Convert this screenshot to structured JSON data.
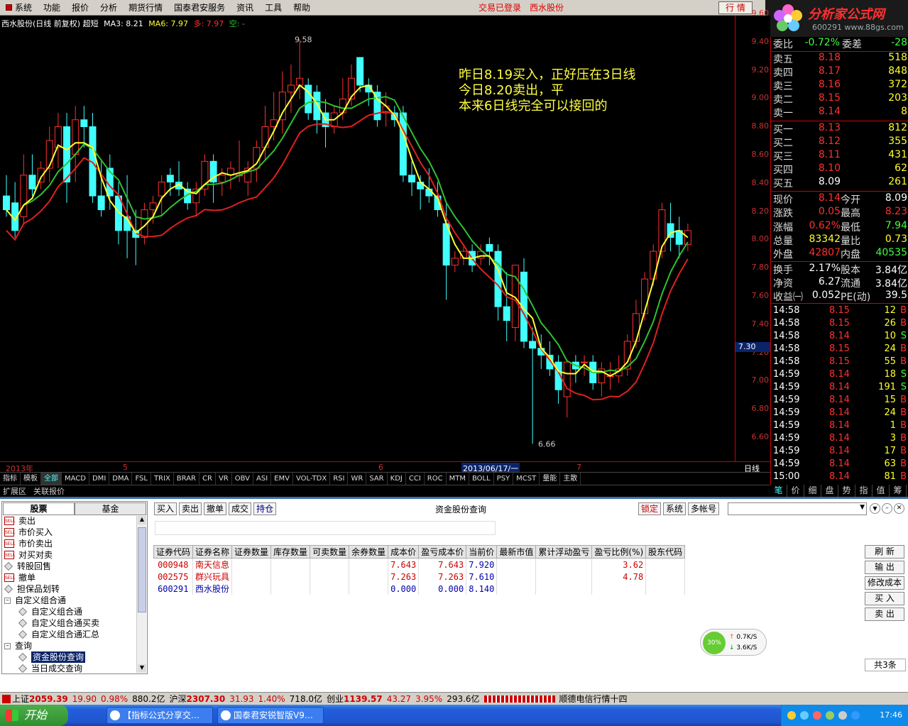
{
  "menu": {
    "items": [
      "系统",
      "功能",
      "报价",
      "分析",
      "期货行情",
      "国泰君安服务",
      "资讯",
      "工具",
      "帮助"
    ],
    "login_status": "交易已登录",
    "stock_name": "西水股份",
    "quote_button": "行 情",
    "logo_text": "分析家公式网",
    "logo_url": "www.88gs.com",
    "logo_code": "600291"
  },
  "chart": {
    "header": {
      "title": "西水股份(日线 前复权) 超短",
      "ma3": "MA3: 8.21",
      "ma6": "MA6: 7.97",
      "duo": "多: 7.97",
      "kong": "空: -"
    },
    "annotation": [
      "昨日8.19买入，正好压在3日线",
      "今日8.20卖出，平",
      "本来6日线完全可以接回的"
    ],
    "high_label": "9.58",
    "low_label": "6.66",
    "cursor_price": "7.30",
    "date_labels": [
      "2013年",
      "5",
      "6",
      "2013/06/17/一",
      "7"
    ],
    "period": "日线",
    "price_ticks": [
      "9.60",
      "9.40",
      "9.20",
      "9.00",
      "8.80",
      "8.60",
      "8.40",
      "8.20",
      "8.00",
      "7.80",
      "7.60",
      "7.40",
      "7.20",
      "7.00",
      "6.80",
      "6.60"
    ],
    "colors": {
      "up": "#ff3030",
      "down": "#40ffff",
      "ma3": "#ffff30",
      "ma6": "#30c030",
      "kong": "#e02020"
    }
  },
  "chart_data": {
    "type": "candlestick",
    "title": "西水股份(日线 前复权) 超短",
    "ylim": [
      6.6,
      9.66
    ],
    "candles": [
      [
        8.45,
        8.6,
        8.3,
        8.35
      ],
      [
        8.4,
        8.55,
        8.15,
        8.2
      ],
      [
        8.3,
        8.75,
        8.25,
        8.6
      ],
      [
        8.6,
        8.75,
        8.45,
        8.5
      ],
      [
        8.55,
        8.7,
        8.5,
        8.65
      ],
      [
        8.65,
        8.95,
        8.55,
        8.85
      ],
      [
        8.8,
        9.05,
        8.65,
        8.95
      ],
      [
        8.95,
        9.05,
        8.4,
        8.55
      ],
      [
        8.75,
        9.1,
        8.55,
        9.0
      ],
      [
        9.0,
        9.1,
        8.8,
        8.95
      ],
      [
        8.95,
        9.05,
        8.4,
        8.45
      ],
      [
        8.45,
        8.7,
        8.3,
        8.35
      ],
      [
        8.65,
        8.75,
        8.35,
        8.45
      ],
      [
        8.45,
        8.55,
        8.1,
        8.2
      ],
      [
        8.3,
        8.6,
        8.0,
        8.2
      ],
      [
        8.2,
        8.35,
        7.95,
        8.15
      ],
      [
        8.15,
        8.4,
        8.1,
        8.35
      ],
      [
        8.35,
        8.45,
        8.25,
        8.4
      ],
      [
        8.45,
        8.6,
        8.3,
        8.55
      ],
      [
        8.6,
        8.65,
        8.45,
        8.55
      ],
      [
        8.55,
        8.7,
        8.45,
        8.5
      ],
      [
        8.5,
        8.55,
        8.35,
        8.4
      ],
      [
        8.4,
        8.55,
        8.3,
        8.5
      ],
      [
        8.5,
        8.75,
        8.45,
        8.7
      ],
      [
        8.7,
        8.75,
        8.4,
        8.55
      ],
      [
        8.55,
        8.65,
        8.45,
        8.6
      ],
      [
        8.6,
        8.7,
        8.5,
        8.65
      ],
      [
        8.6,
        8.85,
        8.55,
        8.6
      ],
      [
        8.55,
        8.7,
        8.45,
        8.65
      ],
      [
        8.65,
        8.85,
        8.55,
        8.8
      ],
      [
        8.8,
        9.1,
        8.7,
        8.95
      ],
      [
        8.95,
        9.2,
        8.85,
        9.0
      ],
      [
        9.0,
        9.35,
        8.9,
        9.2
      ],
      [
        9.2,
        9.4,
        9.05,
        9.25
      ],
      [
        9.25,
        9.58,
        9.15,
        9.3
      ],
      [
        9.25,
        9.3,
        9.0,
        9.05
      ],
      [
        9.2,
        9.25,
        8.9,
        9.0
      ],
      [
        9.05,
        9.15,
        8.8,
        8.95
      ],
      [
        8.95,
        9.1,
        8.9,
        9.05
      ],
      [
        9.05,
        9.3,
        9.0,
        9.15
      ],
      [
        9.15,
        9.4,
        9.1,
        9.3
      ],
      [
        9.45,
        9.45,
        9.2,
        9.25
      ],
      [
        9.25,
        9.3,
        9.1,
        9.2
      ],
      [
        9.2,
        9.25,
        8.95,
        9.0
      ],
      [
        9.05,
        9.2,
        8.95,
        9.1
      ],
      [
        9.05,
        9.1,
        8.95,
        9.0
      ],
      [
        9.05,
        9.1,
        8.55,
        8.6
      ],
      [
        8.6,
        8.7,
        8.45,
        8.55
      ],
      [
        8.55,
        8.6,
        8.35,
        8.5
      ],
      [
        8.5,
        8.65,
        8.4,
        8.45
      ],
      [
        8.45,
        8.55,
        8.3,
        8.35
      ],
      [
        8.25,
        8.4,
        7.7,
        7.95
      ],
      [
        7.95,
        8.05,
        7.9,
        8.0
      ],
      [
        8.0,
        8.1,
        7.95,
        8.05
      ],
      [
        8.05,
        8.1,
        7.9,
        7.95
      ],
      [
        8.0,
        8.1,
        7.95,
        8.05
      ],
      [
        8.1,
        8.15,
        7.95,
        8.05
      ],
      [
        8.05,
        8.1,
        7.55,
        7.65
      ],
      [
        7.65,
        7.9,
        7.4,
        7.55
      ],
      [
        7.5,
        7.95,
        7.4,
        7.95
      ],
      [
        7.9,
        8.0,
        7.35,
        7.4
      ],
      [
        7.4,
        7.5,
        6.66,
        7.35
      ],
      [
        7.35,
        7.45,
        7.2,
        7.3
      ],
      [
        7.3,
        7.4,
        7.15,
        7.2
      ],
      [
        7.25,
        7.3,
        6.95,
        7.05
      ],
      [
        7.0,
        7.25,
        6.85,
        7.25
      ],
      [
        7.25,
        7.3,
        7.1,
        7.2
      ],
      [
        7.25,
        7.3,
        7.15,
        7.25
      ],
      [
        7.25,
        7.3,
        7.05,
        7.1
      ],
      [
        7.1,
        7.25,
        7.0,
        7.2
      ],
      [
        7.15,
        7.25,
        7.05,
        7.15
      ],
      [
        7.15,
        7.3,
        7.1,
        7.2
      ],
      [
        7.2,
        7.45,
        7.15,
        7.4
      ],
      [
        7.4,
        7.7,
        7.35,
        7.6
      ],
      [
        7.6,
        7.9,
        7.55,
        7.85
      ],
      [
        7.85,
        8.1,
        7.8,
        8.05
      ],
      [
        8.05,
        8.4,
        8.0,
        8.35
      ],
      [
        8.25,
        8.4,
        8.05,
        8.15
      ],
      [
        8.2,
        8.3,
        8.0,
        8.1
      ],
      [
        8.1,
        8.25,
        8.05,
        8.2
      ]
    ]
  },
  "indicator_tabs": [
    "指标",
    "模板",
    "全部",
    "MACD",
    "DMI",
    "DMA",
    "FSL",
    "TRIX",
    "BRAR",
    "CR",
    "VR",
    "OBV",
    "ASI",
    "EMV",
    "VOL-TDX",
    "RSI",
    "WR",
    "SAR",
    "KDJ",
    "CCI",
    "ROC",
    "MTM",
    "BOLL",
    "PSY",
    "MCST",
    "量能",
    "主散"
  ],
  "ext_tabs": [
    "扩展区",
    "关联报价"
  ],
  "quote": {
    "header": {
      "label1": "委比",
      "val1": "-0.72%",
      "label2": "委差",
      "val2": "-28"
    },
    "sell": [
      {
        "label": "卖五",
        "price": "8.18",
        "vol": "518"
      },
      {
        "label": "卖四",
        "price": "8.17",
        "vol": "848"
      },
      {
        "label": "卖三",
        "price": "8.16",
        "vol": "372"
      },
      {
        "label": "卖二",
        "price": "8.15",
        "vol": "203"
      },
      {
        "label": "卖一",
        "price": "8.14",
        "vol": "8"
      }
    ],
    "buy": [
      {
        "label": "买一",
        "price": "8.13",
        "vol": "812"
      },
      {
        "label": "买二",
        "price": "8.12",
        "vol": "355"
      },
      {
        "label": "买三",
        "price": "8.11",
        "vol": "431"
      },
      {
        "label": "买四",
        "price": "8.10",
        "vol": "62"
      },
      {
        "label": "买五",
        "price": "8.09",
        "vol": "261"
      }
    ],
    "stats": [
      {
        "l1": "现价",
        "v1": "8.14",
        "l2": "今开",
        "v2": "8.09"
      },
      {
        "l1": "涨跌",
        "v1": "0.05",
        "l2": "最高",
        "v2": "8.23"
      },
      {
        "l1": "涨幅",
        "v1": "0.62%",
        "l2": "最低",
        "v2": "7.94"
      },
      {
        "l1": "总量",
        "v1": "83342",
        "l2": "量比",
        "v2": "0.73"
      },
      {
        "l1": "外盘",
        "v1": "42807",
        "l2": "内盘",
        "v2": "40535"
      },
      {
        "l1": "换手",
        "v1": "2.17%",
        "l2": "股本",
        "v2": "3.84亿"
      },
      {
        "l1": "净资",
        "v1": "6.27",
        "l2": "流通",
        "v2": "3.84亿"
      },
      {
        "l1": "收益㈠",
        "v1": "0.052",
        "l2": "PE(动)",
        "v2": "39.5"
      }
    ],
    "ticks": [
      {
        "t": "14:58",
        "p": "8.15",
        "v": "12",
        "s": "B"
      },
      {
        "t": "14:58",
        "p": "8.15",
        "v": "26",
        "s": "B"
      },
      {
        "t": "14:58",
        "p": "8.14",
        "v": "10",
        "s": "S"
      },
      {
        "t": "14:58",
        "p": "8.15",
        "v": "24",
        "s": "B"
      },
      {
        "t": "14:58",
        "p": "8.15",
        "v": "55",
        "s": "B"
      },
      {
        "t": "14:59",
        "p": "8.14",
        "v": "18",
        "s": "S"
      },
      {
        "t": "14:59",
        "p": "8.14",
        "v": "191",
        "s": "S"
      },
      {
        "t": "14:59",
        "p": "8.14",
        "v": "15",
        "s": "B"
      },
      {
        "t": "14:59",
        "p": "8.14",
        "v": "24",
        "s": "B"
      },
      {
        "t": "14:59",
        "p": "8.14",
        "v": "1",
        "s": "B"
      },
      {
        "t": "14:59",
        "p": "8.14",
        "v": "3",
        "s": "B"
      },
      {
        "t": "14:59",
        "p": "8.14",
        "v": "17",
        "s": "B"
      },
      {
        "t": "14:59",
        "p": "8.14",
        "v": "63",
        "s": "B"
      },
      {
        "t": "15:00",
        "p": "8.14",
        "v": "81",
        "s": "B"
      }
    ],
    "tabs": [
      "笔",
      "价",
      "细",
      "盘",
      "势",
      "指",
      "值",
      "筹"
    ]
  },
  "trade": {
    "left_tabs": [
      "股票",
      "基金"
    ],
    "nav": [
      {
        "label": "卖出",
        "type": "sell"
      },
      {
        "label": "市价买入",
        "type": "sell"
      },
      {
        "label": "市价卖出",
        "type": "sell"
      },
      {
        "label": "对买对卖",
        "type": "sell"
      },
      {
        "label": "转股回售",
        "type": "dia"
      },
      {
        "label": "撤单",
        "type": "sell"
      },
      {
        "label": "担保品划转",
        "type": "dia"
      },
      {
        "label": "自定义组合通",
        "type": "box"
      },
      {
        "label": "自定义组合通",
        "type": "dia2"
      },
      {
        "label": "自定义组合通买卖",
        "type": "dia2"
      },
      {
        "label": "自定义组合通汇总",
        "type": "dia2"
      },
      {
        "label": "查询",
        "type": "box"
      },
      {
        "label": "资金股份查询",
        "type": "dia2",
        "sel": true
      },
      {
        "label": "当日成交查询",
        "type": "dia2"
      }
    ],
    "toolbar": [
      "买入",
      "卖出",
      "撤单",
      "成交",
      "持仓"
    ],
    "title": "资金股份查询",
    "right_buttons": [
      "锁定",
      "系统",
      "多帐号"
    ],
    "columns": [
      "证券代码",
      "证券名称",
      "证券数量",
      "库存数量",
      "可卖数量",
      "余券数量",
      "成本价",
      "盈亏成本价",
      "当前价",
      "最新市值",
      "累计浮动盈亏",
      "盈亏比例(%)",
      "股东代码"
    ],
    "rows": [
      {
        "code": "000948",
        "name": "南天信息",
        "cost": "7.643",
        "pcost": "7.643",
        "price": "7.920",
        "ratio": "3.62"
      },
      {
        "code": "002575",
        "name": "群兴玩具",
        "cost": "7.263",
        "pcost": "7.263",
        "price": "7.610",
        "ratio": "4.78"
      },
      {
        "code": "600291",
        "name": "西水股份",
        "cost": "0.000",
        "pcost": "0.000",
        "price": "8.140",
        "ratio": ""
      }
    ],
    "side_buttons": [
      "刷 新",
      "输 出",
      "修改成本",
      "买 入",
      "卖 出"
    ],
    "total": "共3条",
    "net": {
      "pct": "30%",
      "up": "0.7K/S",
      "down": "3.6K/S"
    }
  },
  "status": {
    "sh_label": "上证",
    "sh": "2059.39",
    "sh_chg": "19.90",
    "sh_pct": "0.98%",
    "sh_amt": "880.2亿",
    "sz_label": "沪深",
    "sz": "2307.30",
    "sz_chg": "31.93",
    "sz_pct": "1.40%",
    "sz_amt": "718.0亿",
    "cy_label": "创业",
    "cy": "1139.57",
    "cy_chg": "43.27",
    "cy_pct": "3.95%",
    "cy_amt": "293.6亿",
    "ticker": "顺德电信行情十四"
  },
  "taskbar": {
    "start": "开始",
    "tasks": [
      "【指标公式分享交…",
      "国泰君安锐智版V9…"
    ],
    "clock": "17:46"
  }
}
